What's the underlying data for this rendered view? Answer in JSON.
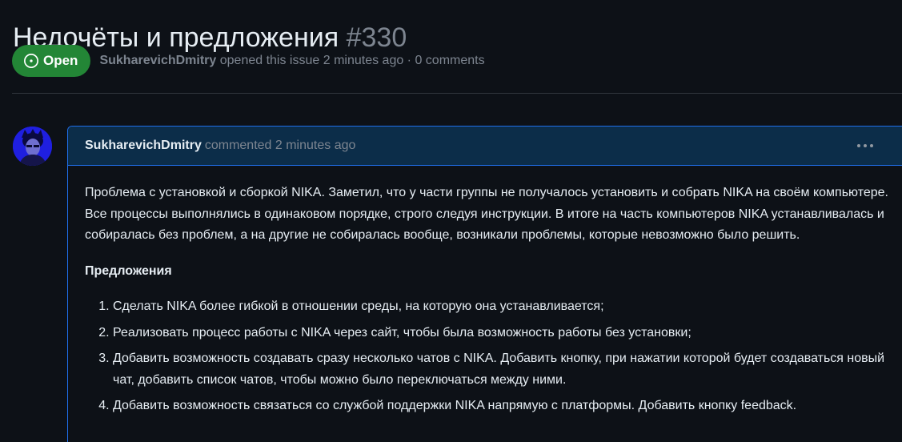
{
  "issue": {
    "title": "Недочёты и предложения",
    "number": "#330",
    "state": "Open",
    "author": "SukharevichDmitry",
    "meta": "opened this issue 2 minutes ago · 0 comments"
  },
  "comment": {
    "author": "SukharevichDmitry",
    "meta": "commented 2 minutes ago",
    "body": "Проблема с установкой и сборкой NIKA. Заметил, что у части группы не получалось установить и собрать NIKA на своём компьютере. Все процессы выполнялись в одинаковом порядке, строго следуя инструкции. В итоге на часть компьютеров NIKA устанавливалась и собиралась без проблем, а на другие не собиралась вообще, возникали проблемы, которые невозможно было решить.",
    "section_heading": "Предложения",
    "proposals": [
      "Сделать NIKA более гибкой в отношении среды, на которую она устанавливается;",
      "Реализовать процесс работы с NIKA через сайт, чтобы была возможность работы без установки;",
      "Добавить возможность создавать сразу несколько чатов с NIKA. Добавить кнопку, при нажатии которой будет создаваться новый чат, добавить список чатов, чтобы можно было переключаться между ними.",
      "Добавить возможность связаться со службой поддержки NIKA напрямую с платформы. Добавить кнопку feedback."
    ]
  },
  "icons": {
    "state": "issue-opened-icon",
    "menu": "kebab-horizontal-icon"
  },
  "colors": {
    "background": "#0d1117",
    "open_badge": "#238636",
    "comment_header": "#0c2d49",
    "comment_border": "#1f6feb",
    "muted_text": "#7d8590"
  }
}
